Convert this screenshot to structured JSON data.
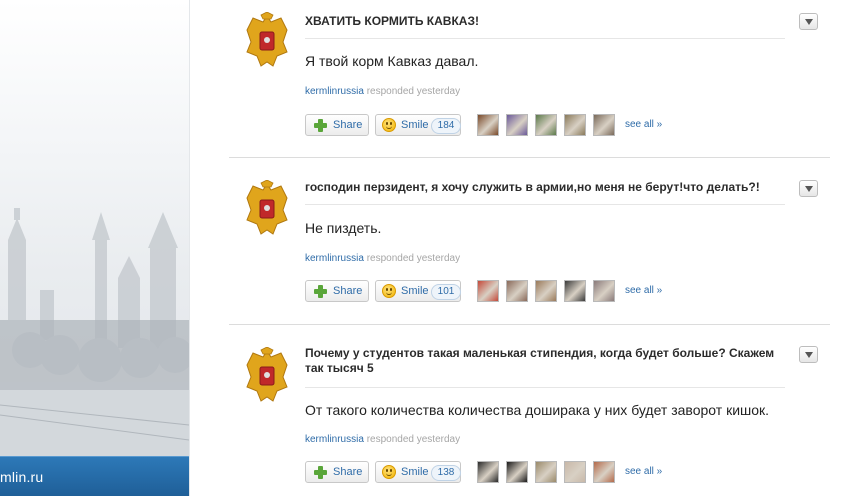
{
  "site": {
    "url_text": "mlin.ru"
  },
  "ui": {
    "share_label": "Share",
    "smile_label": "Smile",
    "see_all_label": "see all »",
    "responded_text": "responded yesterday"
  },
  "posts": [
    {
      "question": "ХВАТИТЬ КОРМИТЬ КАВКАЗ!",
      "answer": "Я твой корм Кавказ давал.",
      "user": "kermlinrussia",
      "smile_count": "184",
      "thumb_colors": [
        "#7a4a2a",
        "#6b5a9a",
        "#5b7a4a",
        "#8a7a5a",
        "#7a6a5a"
      ]
    },
    {
      "question": "господин перзидент, я хочу служить в армии,но меня не берут!что делать?!",
      "answer": "Не пиздеть.",
      "user": "kermlinrussia",
      "smile_count": "101",
      "thumb_colors": [
        "#c44a3a",
        "#8a6a5a",
        "#9a7a5a",
        "#3a3a3a",
        "#8a7a7a"
      ]
    },
    {
      "question": "Почему у студентов такая маленькая стипендия, когда будет больше? Скажем так тысяч 5",
      "answer": "От такого количества количества доширака у них будет заворот кишок.",
      "user": "kermlinrussia",
      "smile_count": "138",
      "thumb_colors": [
        "#2a2a2a",
        "#1a1a1a",
        "#9a8a6a",
        "#c8b8a8",
        "#b46a4a"
      ]
    }
  ]
}
